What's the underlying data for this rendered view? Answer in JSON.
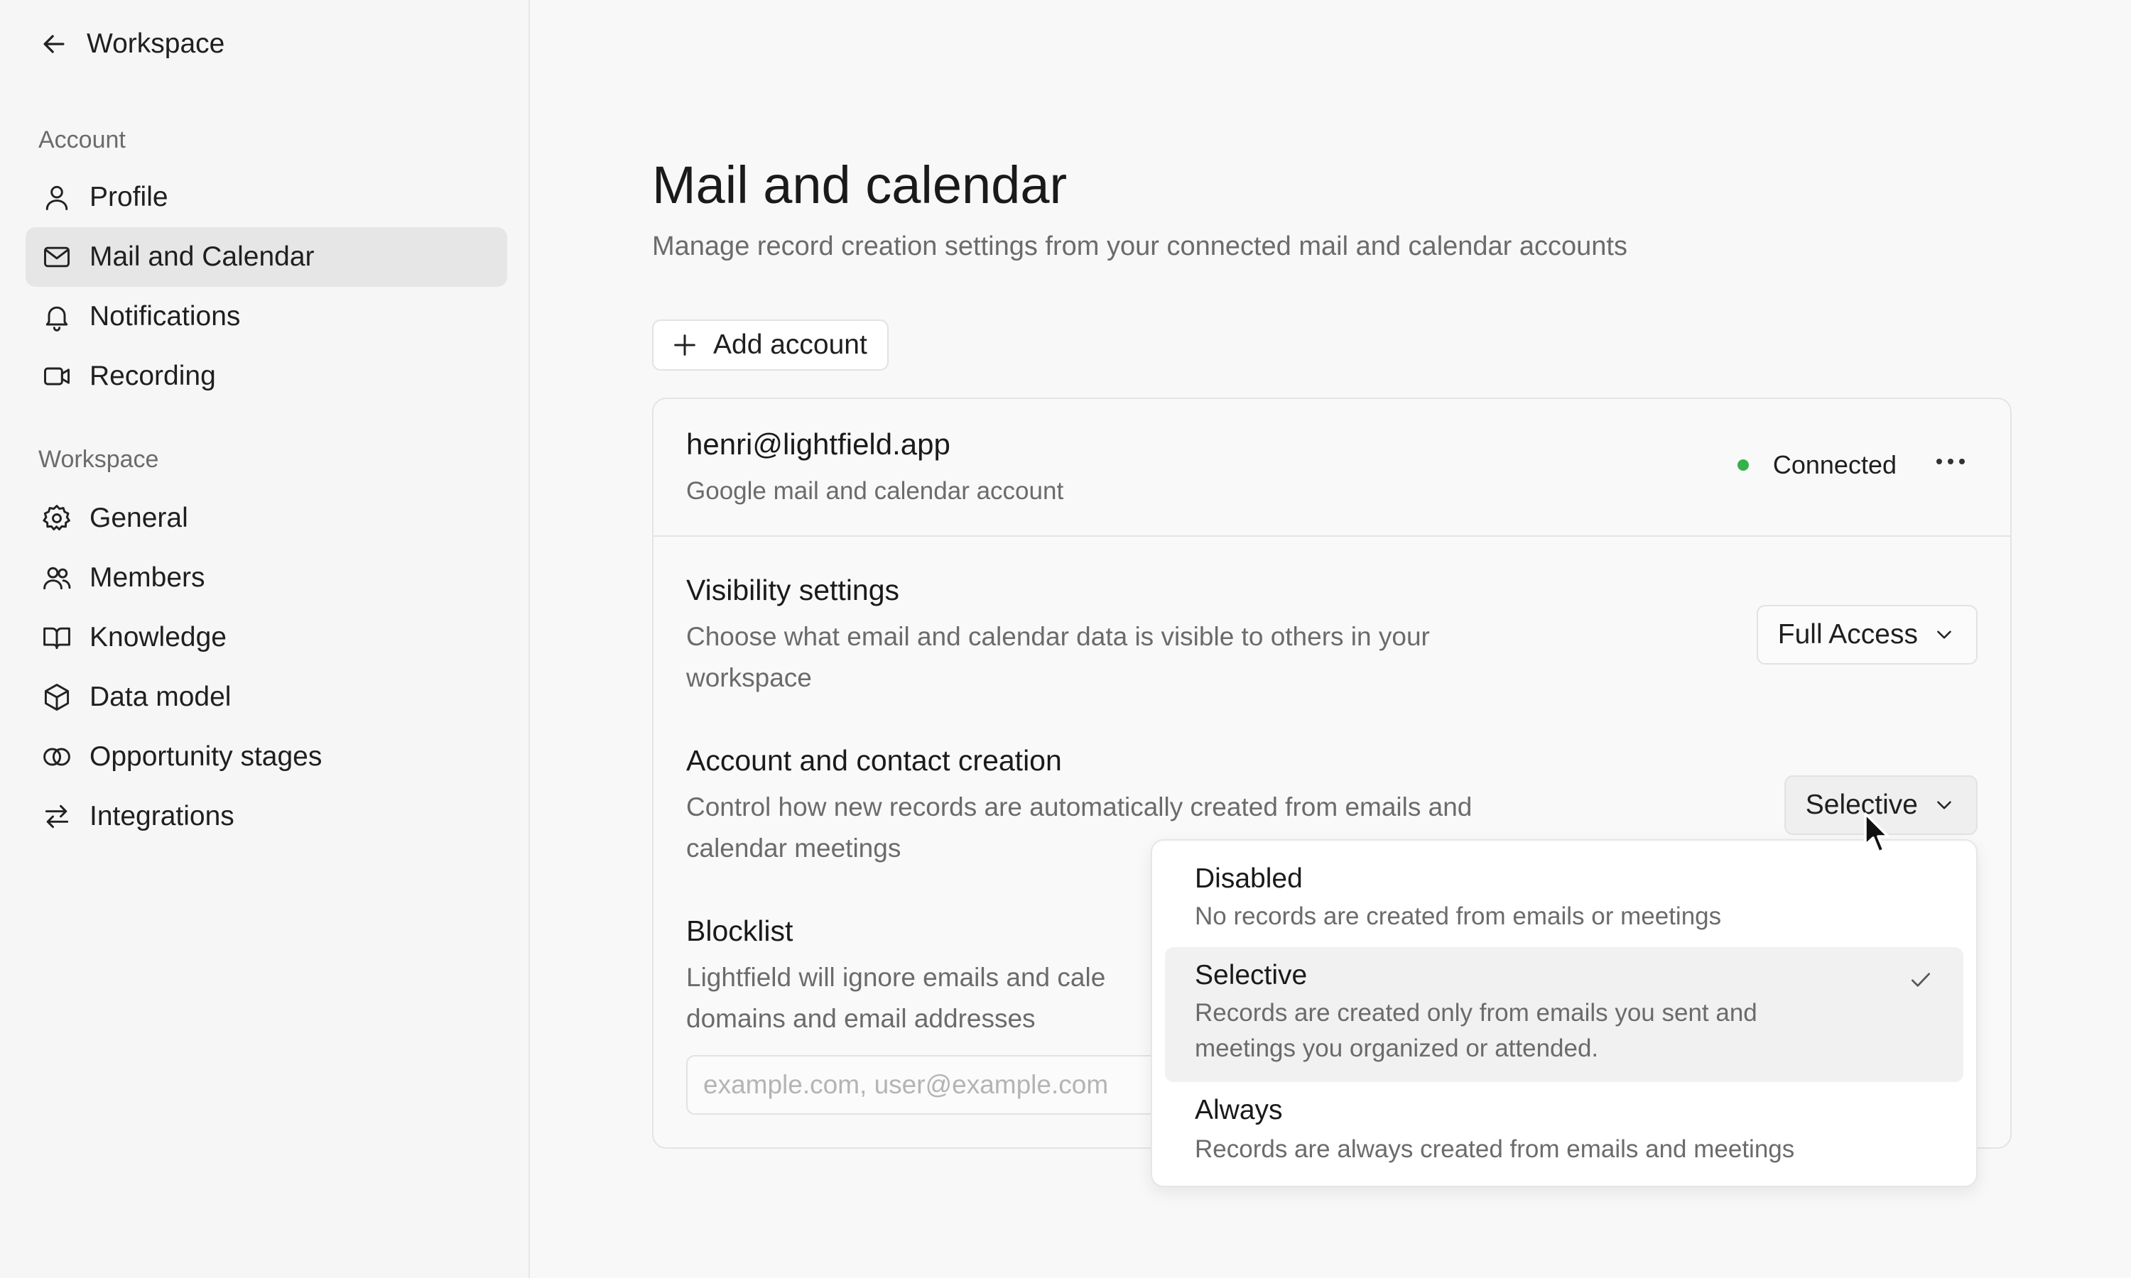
{
  "sidebar": {
    "back_label": "Workspace",
    "account_section": "Account",
    "account_items": [
      {
        "label": "Profile",
        "icon": "user-icon"
      },
      {
        "label": "Mail and Calendar",
        "icon": "mail-icon"
      },
      {
        "label": "Notifications",
        "icon": "bell-icon"
      },
      {
        "label": "Recording",
        "icon": "video-icon"
      }
    ],
    "workspace_section": "Workspace",
    "workspace_items": [
      {
        "label": "General",
        "icon": "gear-icon"
      },
      {
        "label": "Members",
        "icon": "users-icon"
      },
      {
        "label": "Knowledge",
        "icon": "book-icon"
      },
      {
        "label": "Data model",
        "icon": "cube-icon"
      },
      {
        "label": "Opportunity stages",
        "icon": "rings-icon"
      },
      {
        "label": "Integrations",
        "icon": "arrows-icon"
      }
    ],
    "active_item": "Mail and Calendar"
  },
  "main": {
    "title": "Mail and calendar",
    "subtitle": "Manage record creation settings from your connected mail and calendar accounts",
    "add_account_label": "Add account",
    "account": {
      "email": "henri@lightfield.app",
      "type": "Google mail and calendar account",
      "status": "Connected",
      "status_color": "#34b249",
      "more_label": "···"
    },
    "visibility": {
      "title": "Visibility settings",
      "description": "Choose what email and calendar data is visible to others in your workspace",
      "value": "Full Access"
    },
    "creation": {
      "title": "Account and contact creation",
      "description": "Control how new records are automatically created from emails and calendar meetings",
      "value": "Selective"
    },
    "blocklist": {
      "title": "Blocklist",
      "description_visible_line1": "Lightfield will ignore emails and cale",
      "description_visible_line2": "domains and email addresses",
      "placeholder": "example.com, user@example.com"
    }
  },
  "dropdown": {
    "options": [
      {
        "title": "Disabled",
        "description": "No records are created from emails or meetings",
        "selected": false
      },
      {
        "title": "Selective",
        "description": "Records are created only from emails you sent and meetings you organized or attended.",
        "selected": true
      },
      {
        "title": "Always",
        "description": "Records are always created from emails and meetings",
        "selected": false
      }
    ]
  }
}
